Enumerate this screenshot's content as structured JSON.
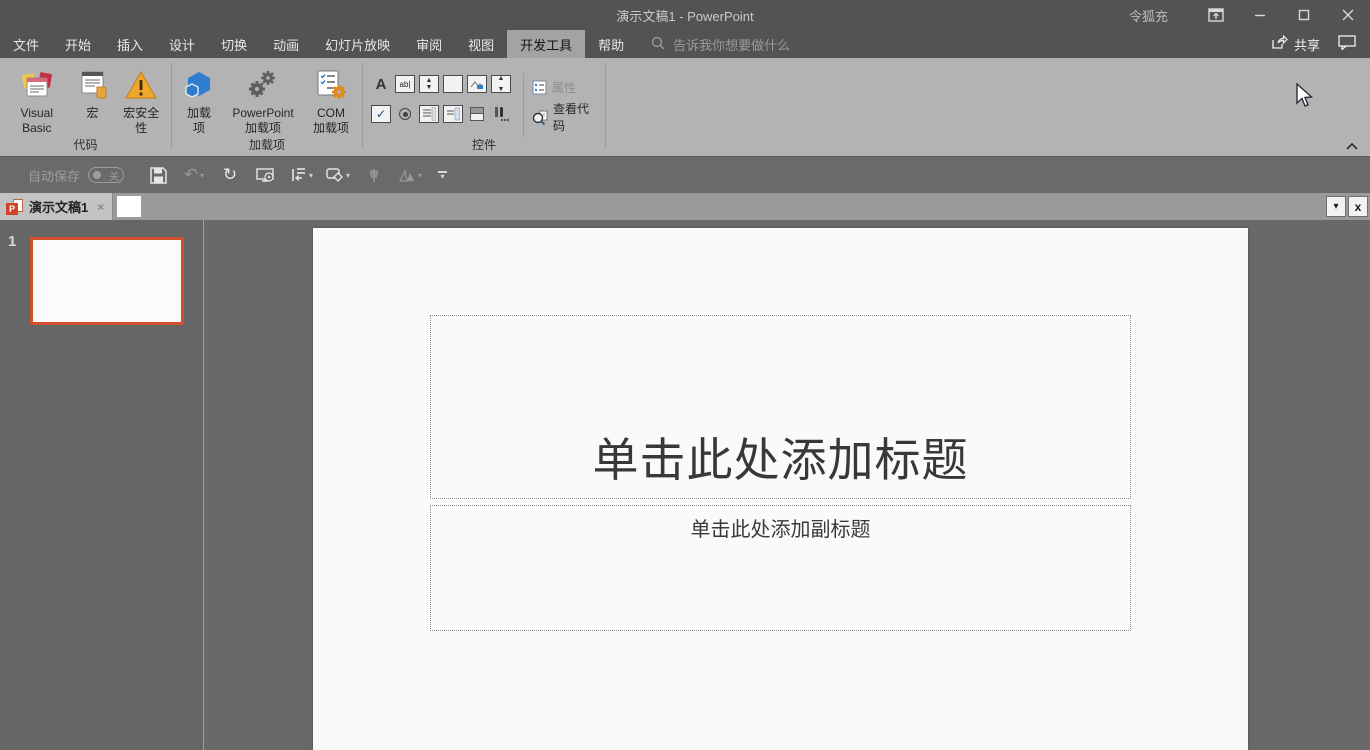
{
  "titlebar": {
    "title": "演示文稿1 - PowerPoint",
    "user": "令狐充",
    "minimize": "—",
    "maximize": "□",
    "close": "✕"
  },
  "menubar": {
    "tabs": [
      "文件",
      "开始",
      "插入",
      "设计",
      "切换",
      "动画",
      "幻灯片放映",
      "审阅",
      "视图",
      "开发工具",
      "帮助"
    ],
    "active_tab": "开发工具",
    "search_placeholder": "告诉我你想要做什么",
    "share_label": "共享"
  },
  "ribbon": {
    "code_group": {
      "label": "代码",
      "visual_basic": "Visual Basic",
      "macros": "宏",
      "macro_security": "宏安全性"
    },
    "addins_group": {
      "label": "加载项",
      "addins": "加载项",
      "ppt_addins": "PowerPoint 加载项",
      "com_addins": "COM 加载项"
    },
    "controls_group": {
      "label": "控件",
      "properties": "属性",
      "view_code": "查看代码"
    }
  },
  "qat": {
    "autosave_label": "自动保存",
    "autosave_state": "关",
    "undo_glyph": "↶",
    "redo_glyph": "↻"
  },
  "document_tabs": {
    "active_tab": "演示文稿1",
    "close_glyph": "×",
    "dropdown_glyph": "▾",
    "closebar_glyph": "x"
  },
  "slides_panel": {
    "slide_number": "1"
  },
  "slide": {
    "title_placeholder": "单击此处添加标题",
    "subtitle_placeholder": "单击此处添加副标题"
  },
  "colors": {
    "accent_orange_red": "#d0502d",
    "titlebar_bg": "#535353",
    "ribbon_bg": "#b3b3b3",
    "addin_blue": "#2f7dd1",
    "warning_yellow": "#f0a62b"
  }
}
